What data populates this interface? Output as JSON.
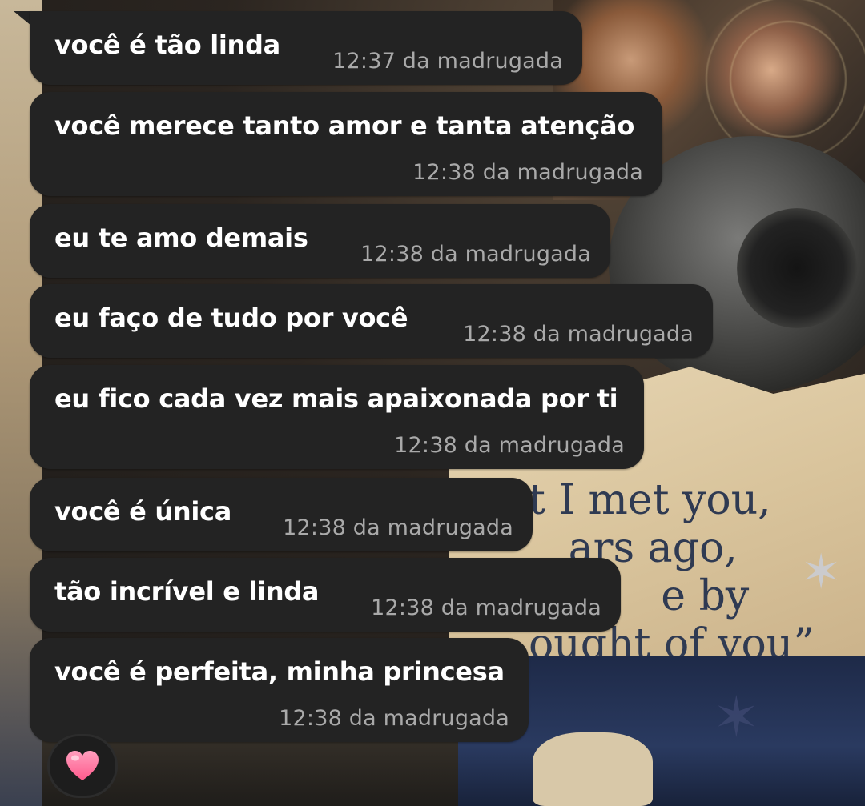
{
  "wallpaper": {
    "quote_text": "t I met you,\n   ars ago,\n          e by\nought of you”"
  },
  "messages": [
    {
      "text": "você é tão linda",
      "time": "12:37 da madrugada"
    },
    {
      "text": "você merece tanto amor e tanta atenção",
      "time": "12:38 da madrugada"
    },
    {
      "text": "eu te amo demais",
      "time": "12:38 da madrugada"
    },
    {
      "text": "eu faço de tudo por você",
      "time": "12:38 da madrugada"
    },
    {
      "text": "eu fico cada vez mais apaixonada por ti",
      "time": "12:38 da madrugada"
    },
    {
      "text": "você é única",
      "time": "12:38 da madrugada"
    },
    {
      "text": "tão incrível e linda",
      "time": "12:38 da madrugada"
    },
    {
      "text": "você é perfeita, minha princesa",
      "time": "12:38 da madrugada"
    }
  ],
  "reaction": {
    "icon": "heart-icon",
    "color": "#ff6f9c"
  },
  "colors": {
    "bubble_bg": "#232323",
    "message_text": "#ffffff",
    "timestamp_text": "#a9a9a9"
  }
}
